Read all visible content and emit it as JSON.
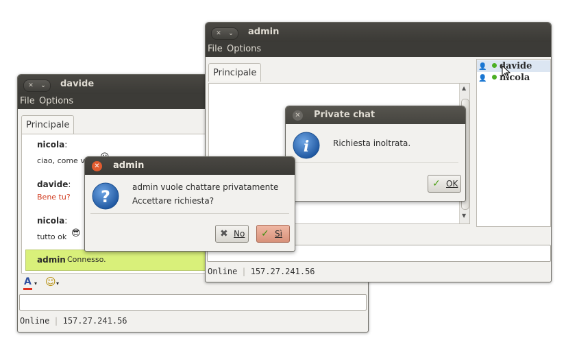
{
  "davide_window": {
    "title": "davide",
    "menu": [
      "File",
      "Options"
    ],
    "tab": "Principale",
    "messages": [
      {
        "name": "nicola",
        "text": "ciao, come v"
      },
      {
        "name": "davide",
        "text": "Bene tu?"
      },
      {
        "name": "nicola",
        "text": "tutto ok"
      }
    ],
    "notice": {
      "name": "admin",
      "text": "Connesso."
    },
    "status": {
      "label": "Online",
      "ip": "157.27.241.56"
    }
  },
  "admin_window": {
    "title": "admin",
    "menu": [
      "File",
      "Options"
    ],
    "tab": "Principale",
    "users": [
      "davide",
      "nicola"
    ],
    "status": {
      "label": "Online",
      "ip": "157.27.241.56"
    }
  },
  "admin_dialog": {
    "title": "admin",
    "line1": "admin vuole chattare privatamente",
    "line2": "Accettare richiesta?",
    "no_label": "No",
    "yes_label": "Sì"
  },
  "private_chat_dialog": {
    "title": "Private chat",
    "message": "Richiesta inoltrata.",
    "ok_label": "OK"
  },
  "colors": {
    "titlebar": "#3c3b37",
    "notice_bg": "#d9f07a",
    "reply_text": "#d03a1e",
    "close_red": "#e25b2f",
    "info_blue": "#2f6db5"
  }
}
